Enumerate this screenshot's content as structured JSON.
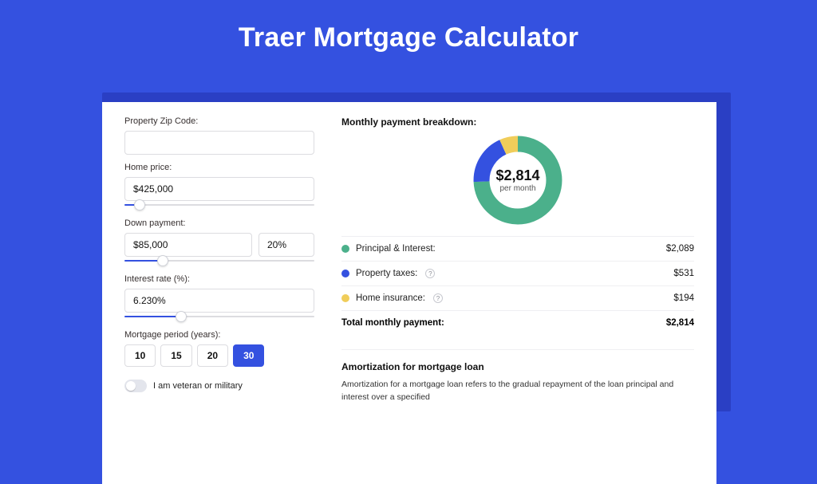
{
  "title": "Traer Mortgage Calculator",
  "form": {
    "zip_label": "Property Zip Code:",
    "zip_value": "",
    "home_price_label": "Home price:",
    "home_price_value": "$425,000",
    "home_price_slider_pct": 8,
    "down_payment_label": "Down payment:",
    "down_payment_value": "$85,000",
    "down_payment_pct": "20%",
    "down_payment_slider_pct": 20,
    "interest_label": "Interest rate (%):",
    "interest_value": "6.230%",
    "interest_slider_pct": 30,
    "period_label": "Mortgage period (years):",
    "periods": [
      "10",
      "15",
      "20",
      "30"
    ],
    "period_selected": "30",
    "veteran_label": "I am veteran or military"
  },
  "breakdown": {
    "heading": "Monthly payment breakdown:",
    "center_amount": "$2,814",
    "center_label": "per month",
    "items": [
      {
        "label": "Principal & Interest:",
        "value": "$2,089",
        "color": "#4bb08b",
        "info": false
      },
      {
        "label": "Property taxes:",
        "value": "$531",
        "color": "#3451e0",
        "info": true
      },
      {
        "label": "Home insurance:",
        "value": "$194",
        "color": "#f0cd5a",
        "info": true
      }
    ],
    "total_label": "Total monthly payment:",
    "total_value": "$2,814"
  },
  "amortization": {
    "heading": "Amortization for mortgage loan",
    "body": "Amortization for a mortgage loan refers to the gradual repayment of the loan principal and interest over a specified"
  },
  "chart_data": {
    "type": "pie",
    "title": "Monthly payment breakdown",
    "series": [
      {
        "name": "Principal & Interest",
        "value": 2089,
        "color": "#4bb08b"
      },
      {
        "name": "Property taxes",
        "value": 531,
        "color": "#3451e0"
      },
      {
        "name": "Home insurance",
        "value": 194,
        "color": "#f0cd5a"
      }
    ],
    "total": 2814,
    "center_label": "$2,814 per month"
  }
}
